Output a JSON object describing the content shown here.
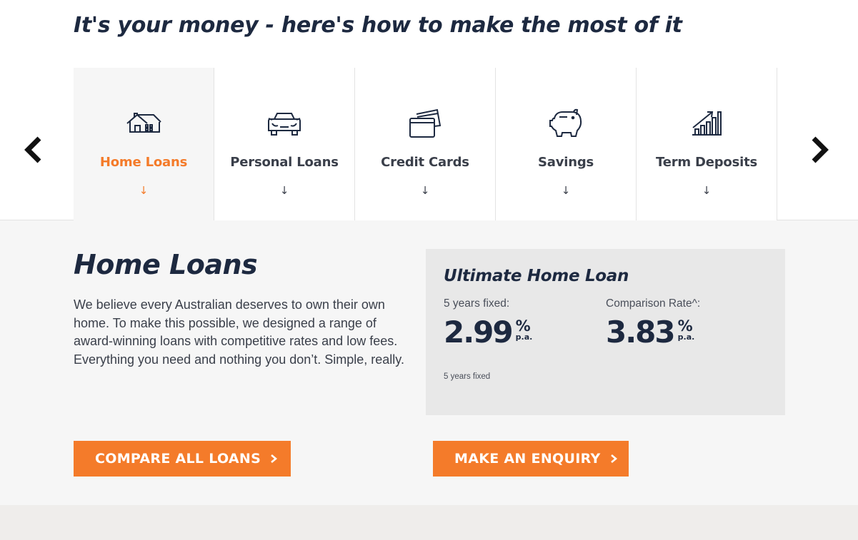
{
  "headline": "It's your money - here's how to make the most of it",
  "carousel": {
    "prev_icon": "chevron-left-icon",
    "next_icon": "chevron-right-icon",
    "tabs": [
      {
        "label": "Home Loans",
        "icon": "house-icon",
        "down": "↓",
        "active": true
      },
      {
        "label": "Personal Loans",
        "icon": "car-icon",
        "down": "↓",
        "active": false
      },
      {
        "label": "Credit Cards",
        "icon": "credit-card-icon",
        "down": "↓",
        "active": false
      },
      {
        "label": "Savings",
        "icon": "piggy-bank-icon",
        "down": "↓",
        "active": false
      },
      {
        "label": "Term Deposits",
        "icon": "growth-chart-icon",
        "down": "↓",
        "active": false
      }
    ]
  },
  "section": {
    "title": "Home Loans",
    "body": "We believe every Australian deserves to own their own home. To make this possible, we designed a range of award-winning loans with competitive rates and low fees. Everything you need and nothing you don’t. Simple, really."
  },
  "rate_card": {
    "title": "Ultimate Home Loan",
    "rates": [
      {
        "label": "5 years fixed:",
        "value": "2.99",
        "pct": "%",
        "pa": "p.a."
      },
      {
        "label": "Comparison Rate^:",
        "value": "3.83",
        "pct": "%",
        "pa": "p.a."
      }
    ],
    "note": "5 years fixed"
  },
  "buttons": {
    "compare": "COMPARE ALL LOANS",
    "enquiry": "MAKE AN ENQUIRY"
  },
  "colors": {
    "accent": "#f47b2a",
    "navy": "#1d2940",
    "panel_bg": "#f6f6f6",
    "card_bg": "#e8e8e8"
  }
}
